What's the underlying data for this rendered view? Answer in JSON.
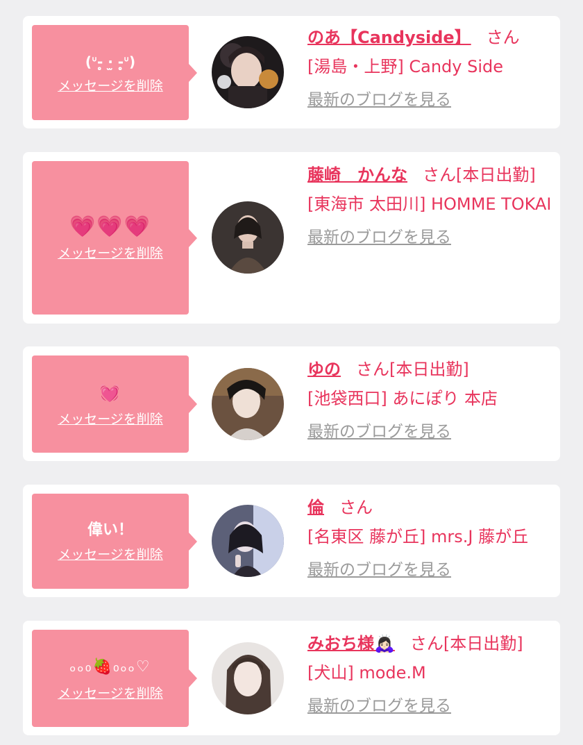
{
  "common": {
    "delete_label": "メッセージを削除",
    "san_suffix": "さん",
    "blog_link": "最新のブログを見る"
  },
  "colors": {
    "bubble": "#f7909f",
    "accent_text": "#e8345c",
    "link_gray": "#9a9a9a",
    "page_bg": "#efeff1"
  },
  "cards": [
    {
      "message": "(ᐡ-̥̥̥ ·̫ -̥̥̥ᐡ)",
      "name": "のあ【Candyside】",
      "status": "",
      "shop": "[湯島・上野] Candy Side"
    },
    {
      "message": "💗💗💗",
      "name": "藤崎　かんな",
      "status": "[本日出勤]",
      "shop": "[東海市 太田川] HOMME TOKAI"
    },
    {
      "message": "💓",
      "name": "ゆの",
      "status": "[本日出勤]",
      "shop": "[池袋西口] あにぽり 本店"
    },
    {
      "message": "偉い！",
      "name": "倫",
      "status": "",
      "shop": "[名東区 藤が丘] mrs.J 藤が丘"
    },
    {
      "message": "ₒₒ₀🍓₀ₒₒ♡",
      "name": "みおち様🙇🏻‍♀️",
      "status": "[本日出勤]",
      "shop": "[犬山] mode.M"
    }
  ]
}
